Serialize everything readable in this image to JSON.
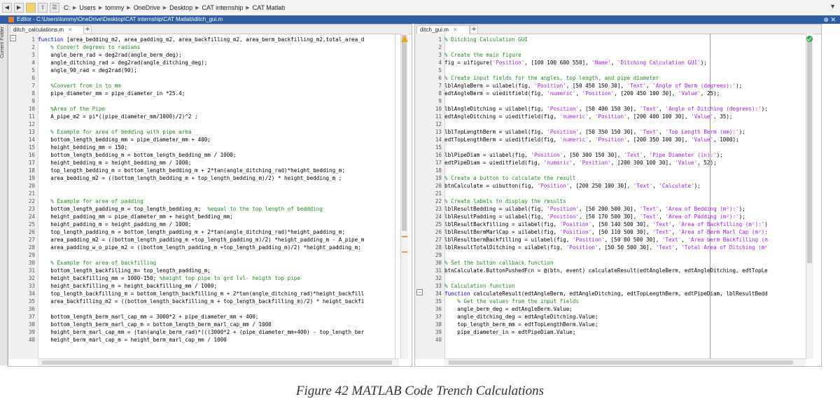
{
  "address_bar": {
    "path": [
      "C:",
      "Users",
      "tommy",
      "OneDrive",
      "Desktop",
      "CAT internship",
      "CAT Matlab"
    ]
  },
  "editor": {
    "title": "Editor - C:\\Users\\tommy\\OneDrive\\Desktop\\CAT internship\\CAT Matlab\\ditch_gui.m",
    "side_label": "Current Folder"
  },
  "left_pane": {
    "tab": "ditch_calculations.m",
    "line_numbers": [
      "1",
      "2",
      "3",
      "4",
      "5",
      "6",
      "7",
      "8",
      "9",
      "10",
      "11",
      "12",
      "13",
      "14",
      "15",
      "16",
      "17",
      "18",
      "19",
      "20",
      "21",
      "22",
      "23",
      "24",
      "25",
      "26",
      "27",
      "28",
      "29",
      "30",
      "31",
      "32",
      "33",
      "34",
      "35",
      "36",
      "37",
      "38",
      "39",
      "40"
    ],
    "lines": [
      [
        {
          "t": "function",
          "c": "kw"
        },
        {
          "t": " [area_bedding_m2, area_padding_m2, area_backfilling_m2, area_berm_backfilling_m2,total_area_d"
        }
      ],
      [
        {
          "t": "    "
        },
        {
          "t": "% Convert degrees to radians",
          "c": "cm"
        }
      ],
      [
        {
          "t": "    angle_berm_rad = deg2rad(angle_berm_deg);"
        }
      ],
      [
        {
          "t": "    angle_ditching_rad = deg2rad(angle_ditching_deg);"
        }
      ],
      [
        {
          "t": "    angle_90_rad = deg2rad(90);"
        }
      ],
      [],
      [
        {
          "t": "    "
        },
        {
          "t": "%Convert from in to mm",
          "c": "cm"
        }
      ],
      [
        {
          "t": "    pipe_diameter_mm = pipe_diameter_in *25.4;"
        }
      ],
      [],
      [
        {
          "t": "    "
        },
        {
          "t": "%Area of the Pipe",
          "c": "cm"
        }
      ],
      [
        {
          "t": "    A_pipe_m2 = pi*((pipe_diameter_mm/1000)/2)^2 ;"
        }
      ],
      [],
      [
        {
          "t": "    "
        },
        {
          "t": "% Example for area of bedding with pipe area",
          "c": "cm"
        }
      ],
      [
        {
          "t": "    bottom_length_bedding_mm = pipe_diameter_mm + 400;"
        }
      ],
      [
        {
          "t": "    height_bedding_mm = 150;"
        }
      ],
      [
        {
          "t": "    bottom_length_bedding_m = bottom_length_bedding_mm / 1000;"
        }
      ],
      [
        {
          "t": "    height_bedding_m = height_bedding_mm / 1000;"
        }
      ],
      [
        {
          "t": "    top_length_bedding_m = bottom_length_bedding_m + 2*tan(angle_ditching_rad)*height_bedding_m;"
        }
      ],
      [
        {
          "t": "    area_bedding_m2 = ((bottom_length_bedding_m + top_length_bedding_m)/2) * height_bedding_m ;"
        }
      ],
      [],
      [],
      [
        {
          "t": "    "
        },
        {
          "t": "% Example for area of padding",
          "c": "cm"
        }
      ],
      [
        {
          "t": "    bottom_length_padding_m = top_length_bedding_m;  "
        },
        {
          "t": "%equal to the top length of beddding",
          "c": "cm"
        }
      ],
      [
        {
          "t": "    height_padding_mm = pipe_diameter_mm + height_bedding_mm;"
        }
      ],
      [
        {
          "t": "    height_padding_m = height_padding_mm / 1000;"
        }
      ],
      [
        {
          "t": "    top_length_padding_m = bottom_length_padding_m + 2*tan(angle_ditching_rad)*height_padding_m;"
        }
      ],
      [
        {
          "t": "    area_padding_m2 = ((bottom_length_padding_m +top_length_padding_m)/2) *height_padding_m - A_pipe_m"
        }
      ],
      [
        {
          "t": "    area_padding_w_o_pipe_m2 = ((bottom_length_padding_m +top_length_padding_m)/2) *height_padding_m;"
        }
      ],
      [],
      [
        {
          "t": "    "
        },
        {
          "t": "% Example for area of backfilling",
          "c": "cm"
        }
      ],
      [
        {
          "t": "    bottom_length_backfilling_m= top_length_padding_m;"
        }
      ],
      [
        {
          "t": "    height_backfilling_mm = 1000-150; "
        },
        {
          "t": "%height top pipe to grd lvl- heigth top pipe",
          "c": "cm"
        }
      ],
      [
        {
          "t": "    height_backfilling_m = height_backfilling_mm / 1000;"
        }
      ],
      [
        {
          "t": "    top_length_backfilling_m = bottom_length_backfilling_m + 2*tan(angle_ditching_rad)*height_backfill"
        }
      ],
      [
        {
          "t": "    area_backfilling_m2 = ((bottom_length_backfilling_m + top_length_backfilling_m)/2) * height_backfi"
        }
      ],
      [],
      [
        {
          "t": "    bottom_length_berm_marl_cap_mm = 3000*2 + pipe_diameter_mm + 400;"
        }
      ],
      [
        {
          "t": "    bottom_length_berm_marl_cap_m = bottom_length_berm_marl_cap_mm / 1000"
        }
      ],
      [
        {
          "t": "    height_berm_marl_cap_mm = (tan(angle_berm_rad)*(((3000*2 + (pipe_diameter_mm+400) - top_length_ber"
        }
      ],
      [
        {
          "t": "    height_berm_marl_cap_m = height_berm_marl_cap_mm / 1000"
        }
      ]
    ]
  },
  "right_pane": {
    "tab": "ditch_gui.m",
    "line_numbers": [
      "1",
      "2",
      "3",
      "4",
      "5",
      "6",
      "7",
      "8",
      "9",
      "10",
      "11",
      "12",
      "13",
      "14",
      "15",
      "16",
      "17",
      "18",
      "19",
      "20",
      "21",
      "22",
      "23",
      "24",
      "25",
      "26",
      "27",
      "28",
      "29",
      "30",
      "31",
      "32",
      "33",
      "34",
      "35",
      "36",
      "37",
      "38",
      "39",
      "40"
    ],
    "lines": [
      [
        {
          "t": "% Ditching Calculation GUI",
          "c": "cm"
        }
      ],
      [],
      [
        {
          "t": "% Create the main figure",
          "c": "cm"
        }
      ],
      [
        {
          "t": "fig = uifigure("
        },
        {
          "t": "'Position'",
          "c": "str"
        },
        {
          "t": ", [100 100 600 550], "
        },
        {
          "t": "'Name'",
          "c": "str"
        },
        {
          "t": ", "
        },
        {
          "t": "'Ditching Calculation GUI'",
          "c": "str"
        },
        {
          "t": ");"
        }
      ],
      [],
      [
        {
          "t": "% Create input fields for the angles, top length, and pipe diameter",
          "c": "cm"
        }
      ],
      [
        {
          "t": "lblAngleBerm = uilabel(fig, "
        },
        {
          "t": "'Position'",
          "c": "str"
        },
        {
          "t": ", [50 450 150 30], "
        },
        {
          "t": "'Text'",
          "c": "str"
        },
        {
          "t": ", "
        },
        {
          "t": "'Angle of Berm (degrees):'",
          "c": "str"
        },
        {
          "t": ");"
        }
      ],
      [
        {
          "t": "edtAngleBerm = uieditfield(fig, "
        },
        {
          "t": "'numeric'",
          "c": "str"
        },
        {
          "t": ", "
        },
        {
          "t": "'Position'",
          "c": "str"
        },
        {
          "t": ", [200 450 100 30], "
        },
        {
          "t": "'Value'",
          "c": "str"
        },
        {
          "t": ", 25);"
        }
      ],
      [],
      [
        {
          "t": "lblAngleDitching = uilabel(fig, "
        },
        {
          "t": "'Position'",
          "c": "str"
        },
        {
          "t": ", [50 400 150 30], "
        },
        {
          "t": "'Text'",
          "c": "str"
        },
        {
          "t": ", "
        },
        {
          "t": "'Angle of Ditching (degrees):'",
          "c": "str"
        },
        {
          "t": ");"
        }
      ],
      [
        {
          "t": "edtAngleDitching = uieditfield(fig, "
        },
        {
          "t": "'numeric'",
          "c": "str"
        },
        {
          "t": ", "
        },
        {
          "t": "'Position'",
          "c": "str"
        },
        {
          "t": ", [200 400 100 30], "
        },
        {
          "t": "'Value'",
          "c": "str"
        },
        {
          "t": ", 35);"
        }
      ],
      [],
      [
        {
          "t": "lblTopLengthBerm = uilabel(fig, "
        },
        {
          "t": "'Position'",
          "c": "str"
        },
        {
          "t": ", [50 350 150 30], "
        },
        {
          "t": "'Text'",
          "c": "str"
        },
        {
          "t": ", "
        },
        {
          "t": "'Top Length Berm (mm):'",
          "c": "str"
        },
        {
          "t": ");"
        }
      ],
      [
        {
          "t": "edtTopLengthBerm = uieditfield(fig, "
        },
        {
          "t": "'numeric'",
          "c": "str"
        },
        {
          "t": ", "
        },
        {
          "t": "'Position'",
          "c": "str"
        },
        {
          "t": ", [200 350 100 30], "
        },
        {
          "t": "'Value'",
          "c": "str"
        },
        {
          "t": ", 1000);"
        }
      ],
      [],
      [
        {
          "t": "lblPipeDiam = uilabel(fig, "
        },
        {
          "t": "'Position'",
          "c": "str"
        },
        {
          "t": ", [50 300 150 30], "
        },
        {
          "t": "'Text'",
          "c": "str"
        },
        {
          "t": ", "
        },
        {
          "t": "'Pipe Diameter (in):'",
          "c": "str"
        },
        {
          "t": ");"
        }
      ],
      [
        {
          "t": "edtPipeDiam = uieditfield(fig, "
        },
        {
          "t": "'numeric'",
          "c": "str"
        },
        {
          "t": ", "
        },
        {
          "t": "'Position'",
          "c": "str"
        },
        {
          "t": ", [200 300 100 30], "
        },
        {
          "t": "'Value'",
          "c": "str"
        },
        {
          "t": ", 52);"
        }
      ],
      [],
      [
        {
          "t": "% Create a button to calculate the result",
          "c": "cm"
        }
      ],
      [
        {
          "t": "btnCalculate = uibutton(fig, "
        },
        {
          "t": "'Position'",
          "c": "str"
        },
        {
          "t": ", [200 250 100 30], "
        },
        {
          "t": "'Text'",
          "c": "str"
        },
        {
          "t": ", "
        },
        {
          "t": "'Calculate'",
          "c": "str"
        },
        {
          "t": ");"
        }
      ],
      [],
      [
        {
          "t": "% Create labels to display the results",
          "c": "cm"
        }
      ],
      [
        {
          "t": "lblResultBedding = uilabel(fig, "
        },
        {
          "t": "'Position'",
          "c": "str"
        },
        {
          "t": ", [50 200 500 30], "
        },
        {
          "t": "'Text'",
          "c": "str"
        },
        {
          "t": ", "
        },
        {
          "t": "'Area of Bedding (m²):'",
          "c": "str"
        },
        {
          "t": ");"
        }
      ],
      [
        {
          "t": "lblResultPadding = uilabel(fig, "
        },
        {
          "t": "'Position'",
          "c": "str"
        },
        {
          "t": ", [50 170 500 30], "
        },
        {
          "t": "'Text'",
          "c": "str"
        },
        {
          "t": ", "
        },
        {
          "t": "'Area of Padding (m²):'",
          "c": "str"
        },
        {
          "t": ");"
        }
      ],
      [
        {
          "t": "lblResultBackfilling = uilabel(fig, "
        },
        {
          "t": "'Position'",
          "c": "str"
        },
        {
          "t": ", [50 140 500 30], "
        },
        {
          "t": "'Text'",
          "c": "str"
        },
        {
          "t": ", "
        },
        {
          "t": "'Area of Backfilling (m²):'",
          "c": "str"
        },
        {
          "t": ")"
        }
      ],
      [
        {
          "t": "lblResultBermMarlCap = uilabel(fig, "
        },
        {
          "t": "'Position'",
          "c": "str"
        },
        {
          "t": ", [50 110 500 30], "
        },
        {
          "t": "'Text'",
          "c": "str"
        },
        {
          "t": ", "
        },
        {
          "t": "'Area of Berm Marl Cap (m²):",
          "c": "str"
        }
      ],
      [
        {
          "t": "lblResultbermBackfilling = uilabel(fig, "
        },
        {
          "t": "'Position'",
          "c": "str"
        },
        {
          "t": ", [50 80 500 30], "
        },
        {
          "t": "'Text'",
          "c": "str"
        },
        {
          "t": ", "
        },
        {
          "t": "'Area berm Backfilling (m",
          "c": "str"
        }
      ],
      [
        {
          "t": "lblResultTotalDitching = uilabel(fig, "
        },
        {
          "t": "'Position'",
          "c": "str"
        },
        {
          "t": ", [50 50 500 30], "
        },
        {
          "t": "'Text'",
          "c": "str"
        },
        {
          "t": ", "
        },
        {
          "t": "'Total Area of Ditching (m²",
          "c": "str"
        }
      ],
      [],
      [
        {
          "t": "% Set the button callback function",
          "c": "cm"
        }
      ],
      [
        {
          "t": "btnCalculate.ButtonPushedFcn = @(btn, event) calculateResult(edtAngleBerm, edtAngleDitching, edtTopLe"
        }
      ],
      [],
      [
        {
          "t": "% Calculation function",
          "c": "cm"
        }
      ],
      [
        {
          "t": "function",
          "c": "kw"
        },
        {
          "t": " calculateResult(edtAngleBerm, edtAngleDitching, edtTopLengthBerm, edtPipeDiam, lblResultBedd"
        }
      ],
      [
        {
          "t": "    "
        },
        {
          "t": "% Get the values from the input fields",
          "c": "cm"
        }
      ],
      [
        {
          "t": "    angle_berm_deg = edtAngleBerm.Value;"
        }
      ],
      [
        {
          "t": "    angle_ditching_deg = edtAngleDitching.Value;"
        }
      ],
      [
        {
          "t": "    top_length_berm_mm = edtTopLengthBerm.Value;"
        }
      ],
      [
        {
          "t": "    pipe_diameter_in = edtPipeDiam.Value;"
        }
      ],
      []
    ]
  },
  "caption": "Figure 42 MATLAB Code  Trench Calculations",
  "colors": {
    "comment": "#228B22",
    "keyword": "#0000ff",
    "string": "#a020f0",
    "titlebar": "#2d5fa6"
  }
}
